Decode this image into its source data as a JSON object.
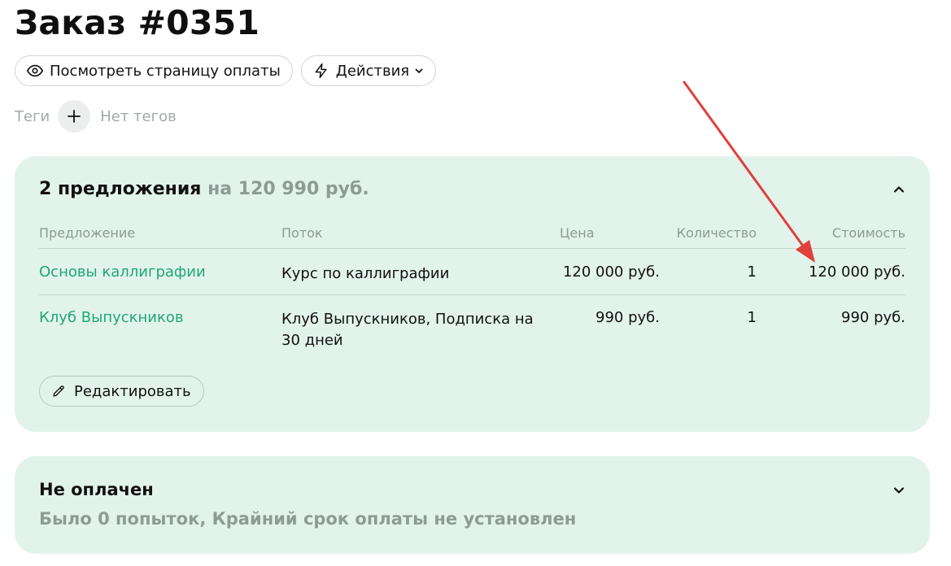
{
  "page": {
    "title": "Заказ #0351"
  },
  "actions": {
    "view_payment_page": "Посмотреть страницу оплаты",
    "actions_menu": "Действия"
  },
  "tags": {
    "label": "Теги",
    "empty": "Нет тегов"
  },
  "offers": {
    "summary_count": "2 предложения",
    "summary_total": "на 120 990 руб.",
    "columns": {
      "offer": "Предложение",
      "flow": "Поток",
      "price": "Цена",
      "quantity": "Количество",
      "cost": "Стоимость"
    },
    "rows": [
      {
        "offer": "Основы каллиграфии",
        "flow": "Курс по каллиграфии",
        "price": "120 000 руб.",
        "quantity": "1",
        "cost": "120 000 руб."
      },
      {
        "offer": "Клуб Выпускников",
        "flow": "Клуб Выпускников, Подписка на 30 дней",
        "price": "990 руб.",
        "quantity": "1",
        "cost": "990 руб."
      }
    ],
    "edit_label": "Редактировать"
  },
  "payment_status": {
    "title": "Не оплачен",
    "subtitle": "Было 0 попыток, Крайний срок оплаты не установлен"
  },
  "colors": {
    "card_bg": "#e2f3ec",
    "link_green": "#1fa874",
    "muted_text": "#8e9a95",
    "annotation_arrow": "#e0413a"
  },
  "icons": {
    "view_payment_page": "eye-icon",
    "actions_menu": "lightning-icon",
    "actions_caret": "chevron-down-icon",
    "tags_add": "plus-icon",
    "offers_toggle": "chevron-up-icon",
    "edit": "pencil-icon",
    "status_toggle": "chevron-down-icon"
  }
}
